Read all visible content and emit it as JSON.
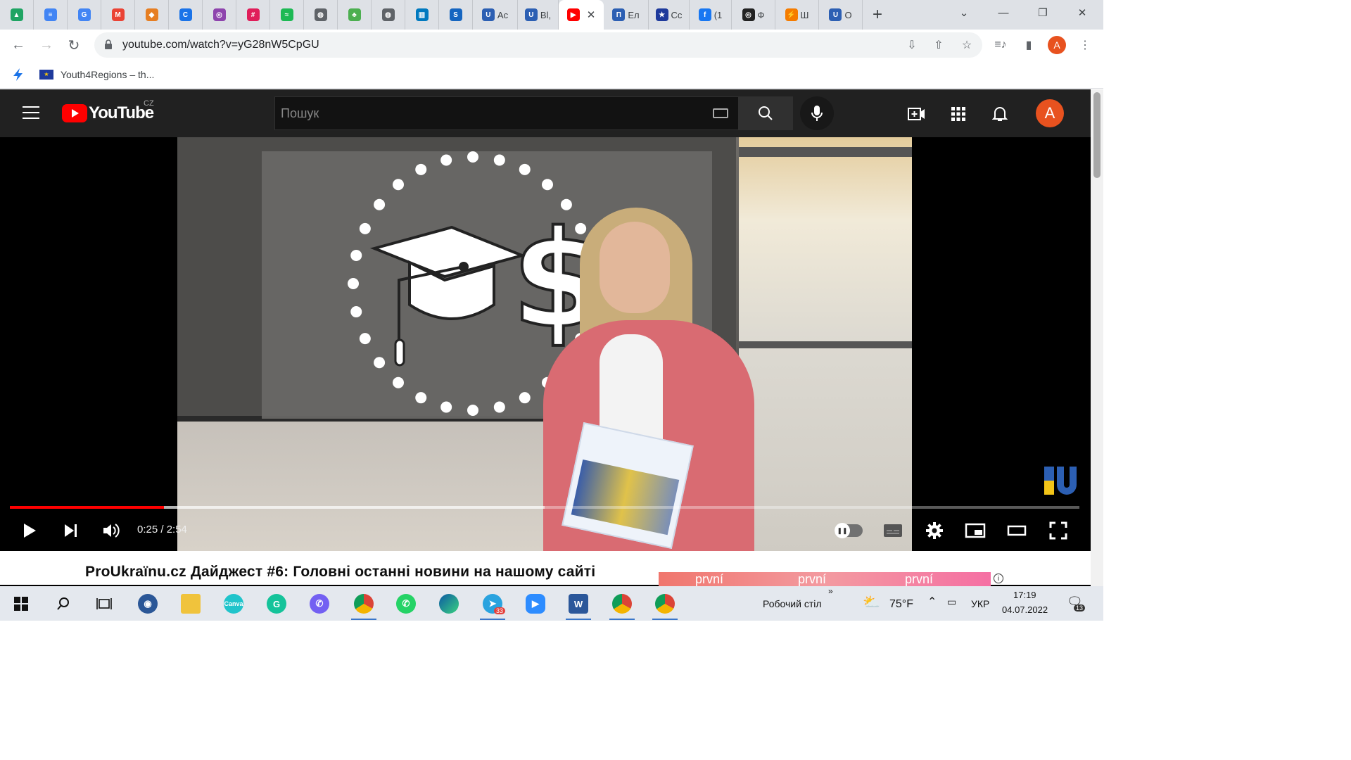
{
  "tabs": [
    {
      "icon": "google-drive-icon",
      "title": ""
    },
    {
      "icon": "google-docs-icon",
      "title": ""
    },
    {
      "icon": "google-translate-icon",
      "title": ""
    },
    {
      "icon": "gmail-icon",
      "title": ""
    },
    {
      "icon": "stack-icon",
      "title": ""
    },
    {
      "icon": "c-icon",
      "title": ""
    },
    {
      "icon": "podcast-icon",
      "title": ""
    },
    {
      "icon": "slack-icon",
      "title": ""
    },
    {
      "icon": "spotify-icon",
      "title": ""
    },
    {
      "icon": "globe-icon",
      "title": ""
    },
    {
      "icon": "plant-icon",
      "title": ""
    },
    {
      "icon": "globe-icon",
      "title": ""
    },
    {
      "icon": "trello-icon",
      "title": ""
    },
    {
      "icon": "s-icon",
      "title": ""
    },
    {
      "icon": "u-icon",
      "title": "Ac"
    },
    {
      "icon": "u-icon",
      "title": "Bl,"
    },
    {
      "icon": "youtube-icon",
      "title": "",
      "active": true
    },
    {
      "icon": "pu-icon",
      "title": "Ел"
    },
    {
      "icon": "eu-flag-icon",
      "title": "Сс"
    },
    {
      "icon": "facebook-icon",
      "title": "(1"
    },
    {
      "icon": "photo-icon",
      "title": "Ф"
    },
    {
      "icon": "bolt-icon",
      "title": "Ш"
    },
    {
      "icon": "u-icon",
      "title": "О"
    }
  ],
  "address_bar": {
    "url": "youtube.com/watch?v=yG28nW5CpGU"
  },
  "bookmarks": [
    {
      "label": ""
    },
    {
      "label": "Youth4Regions – th..."
    }
  ],
  "profile_initial": "A",
  "youtube": {
    "logo_text": "YouTube",
    "country": "CZ",
    "search_placeholder": "Пошук",
    "avatar_initial": "A"
  },
  "player": {
    "time": "0:25 / 2:54",
    "progress_fraction": 0.144,
    "buffered_fraction": 0.5
  },
  "video": {
    "title": "ProUkraïnu.cz Дайджест #6: Головні останні новини на нашому сайті",
    "ad_words": [
      "první",
      "první",
      "první"
    ]
  },
  "taskbar": {
    "desktop_label": "Робочий стіл",
    "temperature": "75°F",
    "language": "УКР",
    "clock_time": "17:19",
    "clock_date": "04.07.2022",
    "telegram_badge": "33",
    "notification_count": "13"
  },
  "colors": {
    "youtube_red": "#ff0000",
    "avatar_orange": "#e8521f"
  }
}
